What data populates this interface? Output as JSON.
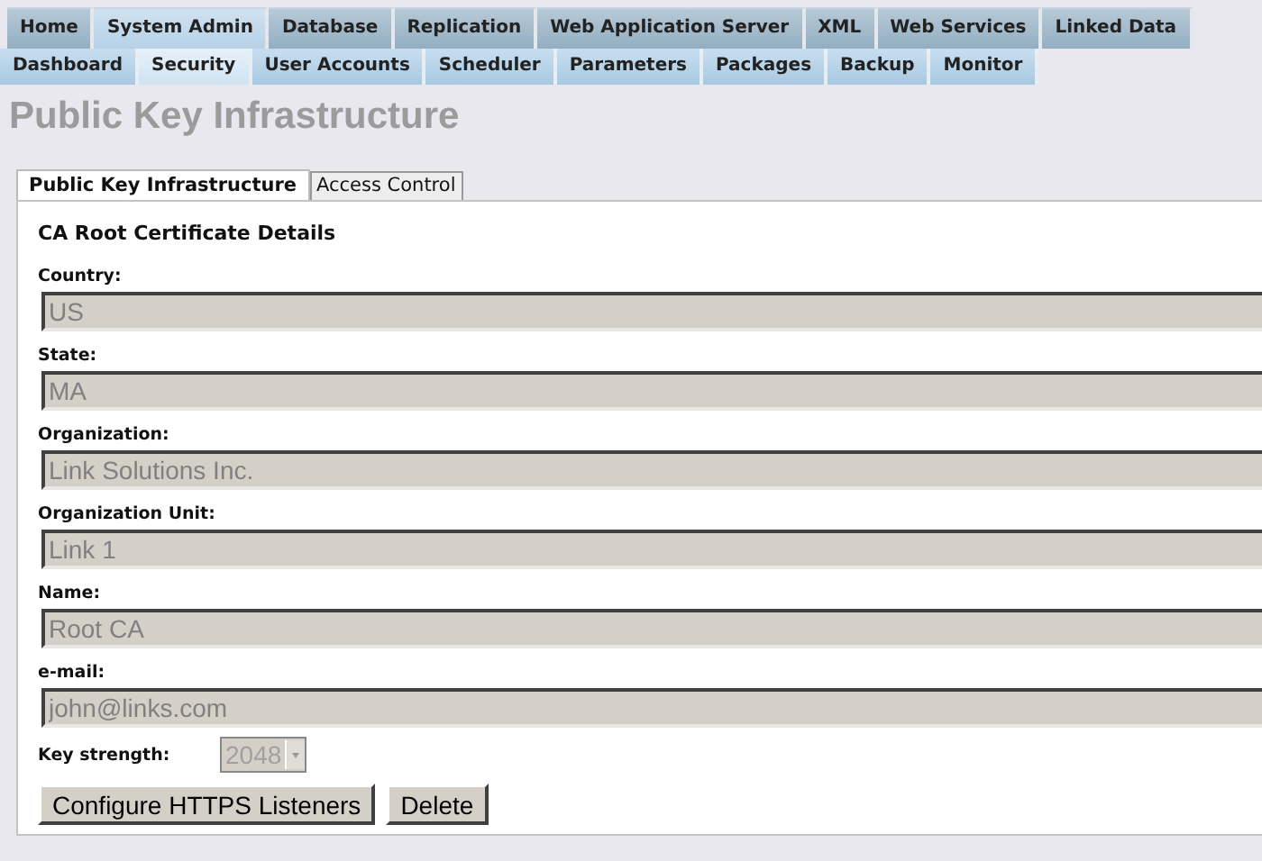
{
  "main_tabs": [
    {
      "label": "Home",
      "selected": false
    },
    {
      "label": "System Admin",
      "selected": true
    },
    {
      "label": "Database",
      "selected": false
    },
    {
      "label": "Replication",
      "selected": false
    },
    {
      "label": "Web Application Server",
      "selected": false
    },
    {
      "label": "XML",
      "selected": false
    },
    {
      "label": "Web Services",
      "selected": false
    },
    {
      "label": "Linked Data",
      "selected": false
    }
  ],
  "sub_tabs": [
    {
      "label": "Dashboard",
      "selected": false
    },
    {
      "label": "Security",
      "selected": true
    },
    {
      "label": "User Accounts",
      "selected": false
    },
    {
      "label": "Scheduler",
      "selected": false
    },
    {
      "label": "Parameters",
      "selected": false
    },
    {
      "label": "Packages",
      "selected": false
    },
    {
      "label": "Backup",
      "selected": false
    },
    {
      "label": "Monitor",
      "selected": false
    }
  ],
  "page_title": "Public Key Infrastructure",
  "panel_tabs": [
    {
      "label": "Public Key Infrastructure",
      "selected": true
    },
    {
      "label": "Access Control",
      "selected": false
    }
  ],
  "section_title": "CA Root Certificate Details",
  "fields": [
    {
      "label": "Country:",
      "value": "US",
      "disabled": true
    },
    {
      "label": "State:",
      "value": "MA",
      "disabled": true
    },
    {
      "label": "Organization:",
      "value": "Link Solutions Inc.",
      "disabled": true
    },
    {
      "label": "Organization Unit:",
      "value": "Link 1",
      "disabled": true
    },
    {
      "label": "Name:",
      "value": "Root CA",
      "disabled": true
    },
    {
      "label": "e-mail:",
      "value": "john@links.com",
      "disabled": true
    }
  ],
  "key_strength": {
    "label": "Key strength:",
    "value": "2048",
    "disabled": true
  },
  "buttons": [
    "Configure HTTPS Listeners",
    "Delete"
  ]
}
